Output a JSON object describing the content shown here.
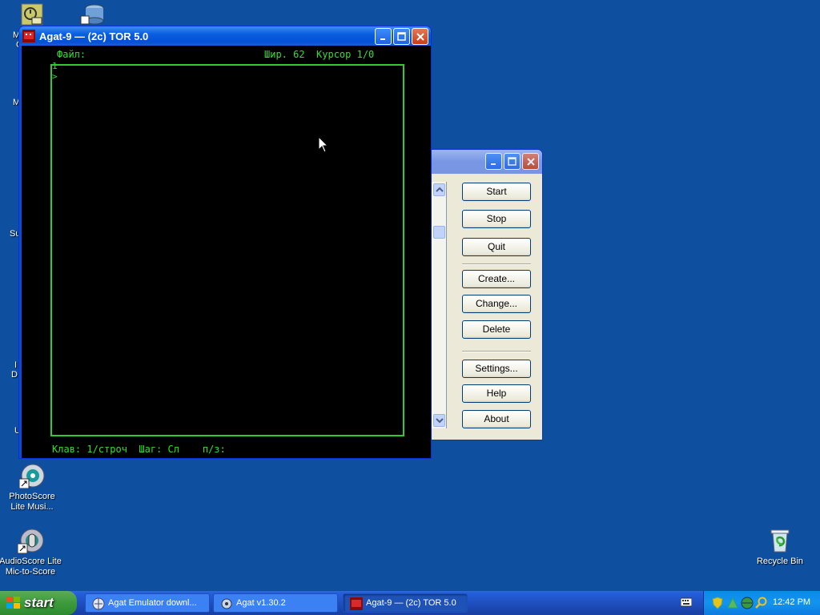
{
  "desktop": {
    "icons": [
      {
        "label": "PhotoScore Lite Musi...",
        "icon": "photoscore-icon"
      },
      {
        "label": "AudioScore Lite Mic-to-Score",
        "icon": "audioscore-icon"
      },
      {
        "label": "Recycle Bin",
        "icon": "recycle-bin-icon"
      }
    ],
    "clipped_labels": [
      "M",
      "C",
      "M",
      "Su",
      "I",
      "D",
      "U"
    ]
  },
  "agat_window": {
    "title": "Agat-9 — (2c) TOR 5.0",
    "screen": {
      "top_left": "Файл:",
      "top_right": "Шир. 62  Курсор 1/0",
      "prompt_line1": "1",
      "prompt_line2": ">",
      "bottom": "Клав: 1/строч  Шаг: Сл    п/з:"
    },
    "screen_color": "#33dd33"
  },
  "control_window": {
    "buttons": [
      "Start",
      "Stop",
      "Quit",
      "Create...",
      "Change...",
      "Delete",
      "Settings...",
      "Help",
      "About"
    ]
  },
  "taskbar": {
    "start_label": "start",
    "tasks": [
      {
        "label": "Agat Emulator downl...",
        "icon": "browser-icon"
      },
      {
        "label": "Agat v1.30.2",
        "icon": "app-icon"
      },
      {
        "label": "Agat-9 — (2c) TOR 5.0",
        "icon": "agat-icon",
        "active": true
      }
    ],
    "clock": "12:42 PM"
  }
}
